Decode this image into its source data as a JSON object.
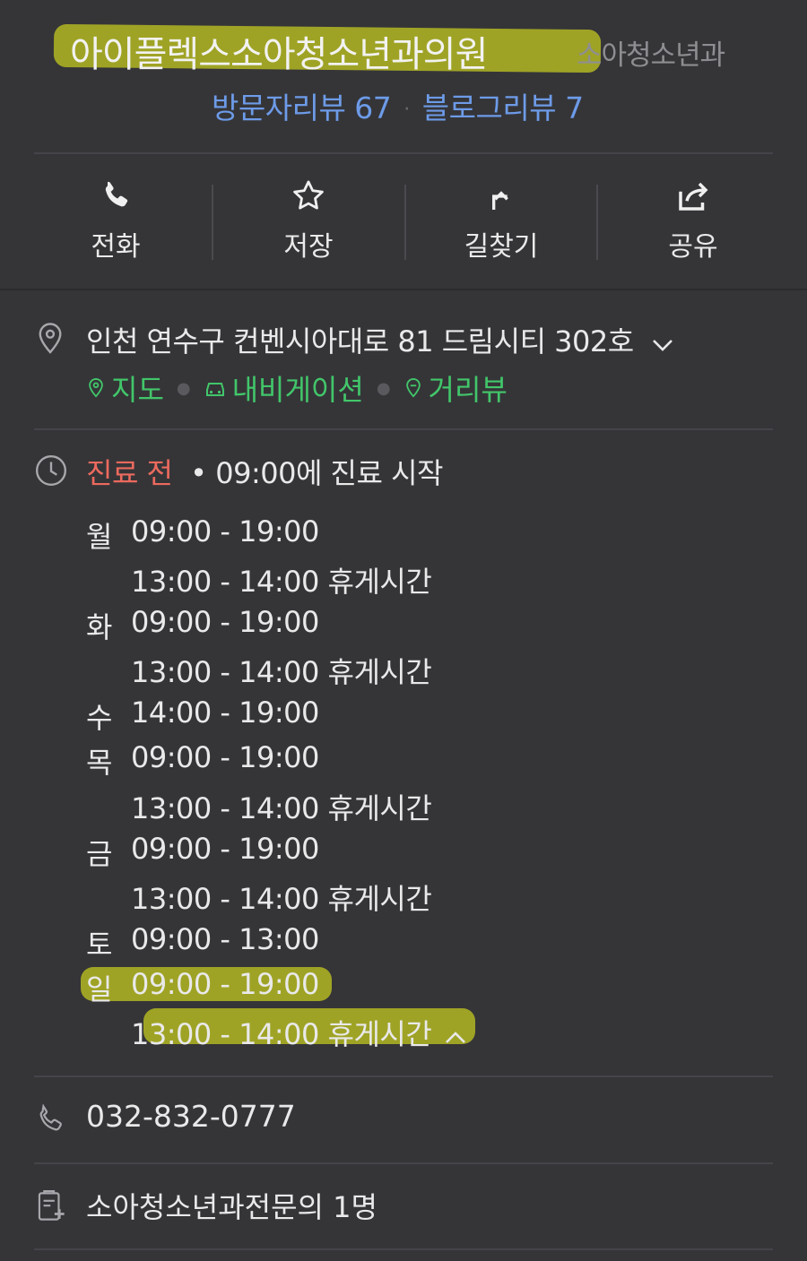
{
  "header": {
    "title": "아이플렉스소아청소년과의원",
    "category": "소아청소년과",
    "visitor_reviews": "방문자리뷰 67",
    "blog_reviews": "블로그리뷰 7"
  },
  "actions": [
    {
      "label": "전화",
      "icon": "phone-icon"
    },
    {
      "label": "저장",
      "icon": "star-icon"
    },
    {
      "label": "길찾기",
      "icon": "directions-icon"
    },
    {
      "label": "공유",
      "icon": "share-icon"
    }
  ],
  "address": {
    "text": "인천 연수구 컨벤시아대로 81 드림시티 302호",
    "links": [
      "지도",
      "내비게이션",
      "거리뷰"
    ]
  },
  "hours": {
    "status": "진료 전",
    "status_detail": "• 09:00에 진료 시작",
    "days": [
      {
        "day": "월",
        "time": "09:00 - 19:00",
        "break": "13:00 - 14:00 휴게시간"
      },
      {
        "day": "화",
        "time": "09:00 - 19:00",
        "break": "13:00 - 14:00 휴게시간"
      },
      {
        "day": "수",
        "time": "14:00 - 19:00",
        "break": ""
      },
      {
        "day": "목",
        "time": "09:00 - 19:00",
        "break": "13:00 - 14:00 휴게시간"
      },
      {
        "day": "금",
        "time": "09:00 - 19:00",
        "break": "13:00 - 14:00 휴게시간"
      },
      {
        "day": "토",
        "time": "09:00 - 13:00",
        "break": ""
      },
      {
        "day": "일",
        "time": "09:00 - 19:00",
        "break": "13:00 - 14:00 휴게시간"
      }
    ]
  },
  "phone": "032-832-0777",
  "specialist": "소아청소년과전문의 1명",
  "colors": {
    "background": "#353538",
    "link_blue": "#6d9be8",
    "link_green": "#42c66a",
    "status_red": "#ec6a5e",
    "highlighter": "#c9cf1f"
  }
}
